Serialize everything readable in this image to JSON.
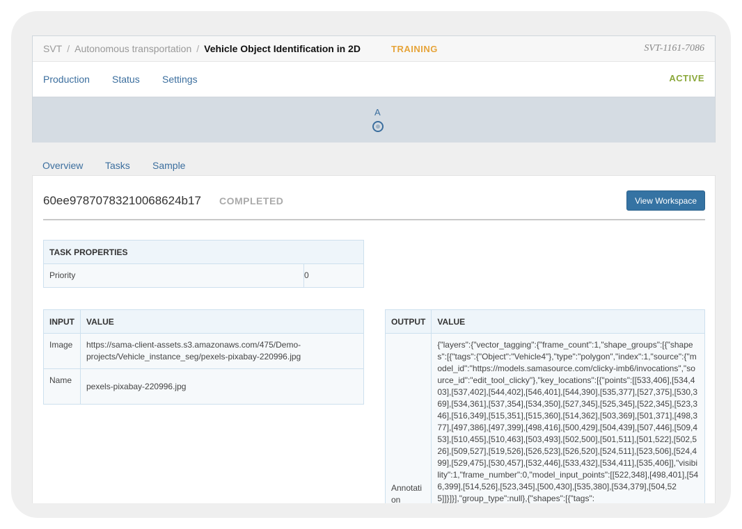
{
  "breadcrumb": {
    "root": "SVT",
    "parent": "Autonomous transportation",
    "current": "Vehicle Object Identification in 2D",
    "separator": "/"
  },
  "project": {
    "stage_status": "TRAINING",
    "code": "SVT-1161-7086",
    "state": "ACTIVE"
  },
  "nav": {
    "production": "Production",
    "status": "Status",
    "settings": "Settings"
  },
  "stage": {
    "label": "A"
  },
  "tabs": {
    "overview": "Overview",
    "tasks": "Tasks",
    "sample": "Sample"
  },
  "task": {
    "id": "60ee97870783210068624b17",
    "status": "COMPLETED",
    "view_button": "View Workspace"
  },
  "task_properties": {
    "header": "TASK PROPERTIES",
    "rows": [
      {
        "key": "Priority",
        "value": "0"
      }
    ]
  },
  "input_table": {
    "headers": [
      "INPUT",
      "VALUE"
    ],
    "rows": [
      {
        "key": "Image",
        "value": "https://sama-client-assets.s3.amazonaws.com/475/Demo-projects/Vehicle_instance_seg/pexels-pixabay-220996.jpg"
      },
      {
        "key": "Name",
        "value": "pexels-pixabay-220996.jpg"
      }
    ]
  },
  "output_table": {
    "headers": [
      "OUTPUT",
      "VALUE"
    ],
    "rows": [
      {
        "key": "Annotation",
        "value": "{\"layers\":{\"vector_tagging\":{\"frame_count\":1,\"shape_groups\":[{\"shapes\":[{\"tags\":{\"Object\":\"Vehicle4\"},\"type\":\"polygon\",\"index\":1,\"source\":{\"model_id\":\"https://models.samasource.com/clicky-imb6/invocations\",\"source_id\":\"edit_tool_clicky\"},\"key_locations\":[{\"points\":[[533,406],[534,403],[537,402],[544,402],[546,401],[544,390],[535,377],[527,375],[530,369],[534,361],[537,354],[534,350],[527,345],[525,345],[522,345],[523,346],[516,349],[515,351],[515,360],[514,362],[503,369],[501,371],[498,377],[497,386],[497,399],[498,416],[500,429],[504,439],[507,446],[509,453],[510,455],[510,463],[503,493],[502,500],[501,511],[501,522],[502,526],[509,527],[519,526],[526,523],[526,520],[524,511],[523,506],[524,499],[529,475],[530,457],[532,446],[533,432],[534,411],[535,406]],\"visibility\":1,\"frame_number\":0,\"model_input_points\":[[522,348],[498,401],[546,399],[514,526],[523,345],[500,430],[535,380],[534,379],[504,525]]}]}],\"group_type\":null},{\"shapes\":[{\"tags\":"
      }
    ]
  }
}
